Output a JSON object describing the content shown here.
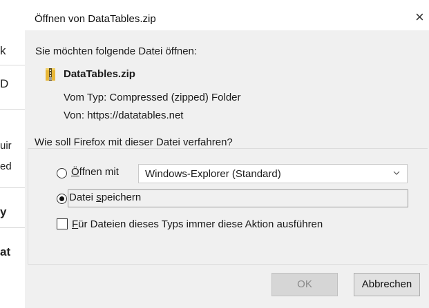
{
  "background_page": {
    "fragments": [
      "k",
      "D",
      "uir",
      "ed",
      "y",
      "at"
    ]
  },
  "dialog": {
    "title": "Öffnen von DataTables.zip",
    "close_glyph": "×",
    "prompt": "Sie möchten folgende Datei öffnen:",
    "file": {
      "icon": "zip-archive-icon",
      "name": "DataTables.zip",
      "type_line": "Vom Typ:  Compressed (zipped) Folder",
      "from_line": "Von:  https://datatables.net"
    },
    "group_label": "Wie soll Firefox mit dieser Datei verfahren?",
    "open_with": {
      "label_prefix": "",
      "label_accel": "Ö",
      "label_rest": "ffnen mit",
      "selected": false,
      "app_select_value": "Windows-Explorer (Standard)"
    },
    "save_file": {
      "label_prefix": "Datei ",
      "label_accel": "s",
      "label_rest": "peichern",
      "selected": true
    },
    "always_checkbox": {
      "label_accel": "F",
      "label_rest": "ür Dateien dieses Typs immer diese Aktion ausführen",
      "checked": false
    },
    "buttons": {
      "ok_label": "OK",
      "ok_enabled": false,
      "cancel_label": "Abbrechen"
    }
  }
}
